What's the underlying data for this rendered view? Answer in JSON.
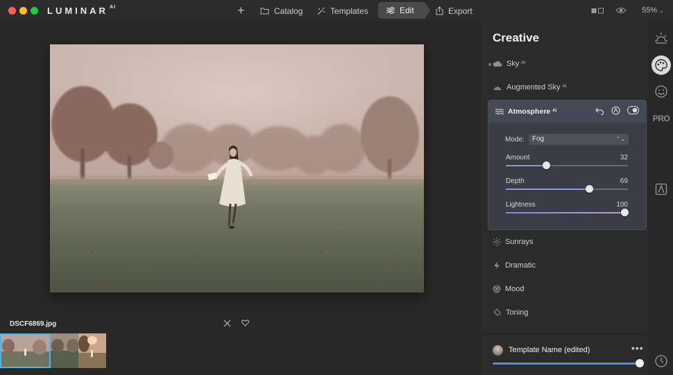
{
  "app": {
    "logo": "LUMINAR",
    "logo_suffix": "AI"
  },
  "topbar": {
    "catalog": "Catalog",
    "templates": "Templates",
    "edit": "Edit",
    "export": "Export",
    "zoom": "55%"
  },
  "canvas": {
    "filename": "DSCF6869.jpg"
  },
  "panel": {
    "title": "Creative",
    "ai_badge": "AI",
    "tools": {
      "sky": "Sky",
      "augmented_sky": "Augmented Sky",
      "atmosphere": "Atmosphere",
      "sunrays": "Sunrays",
      "dramatic": "Dramatic",
      "mood": "Mood",
      "toning": "Toning"
    },
    "atmosphere": {
      "mode_label": "Mode:",
      "mode_value": "Fog",
      "sliders": [
        {
          "label": "Amount",
          "value": "32",
          "fraction": 0.33
        },
        {
          "label": "Depth",
          "value": "69",
          "fraction": 0.68
        },
        {
          "label": "Lightness",
          "value": "100",
          "fraction": 0.97
        }
      ]
    },
    "template": {
      "name": "Template Name (edited)",
      "more": "•••",
      "fraction": 1.0
    }
  },
  "rail": {
    "pro": "PRO"
  },
  "colors": {
    "accent": "#4fb3e8",
    "slider_blue": "#4a8ff0",
    "panel_highlight": "#3a3d45"
  }
}
